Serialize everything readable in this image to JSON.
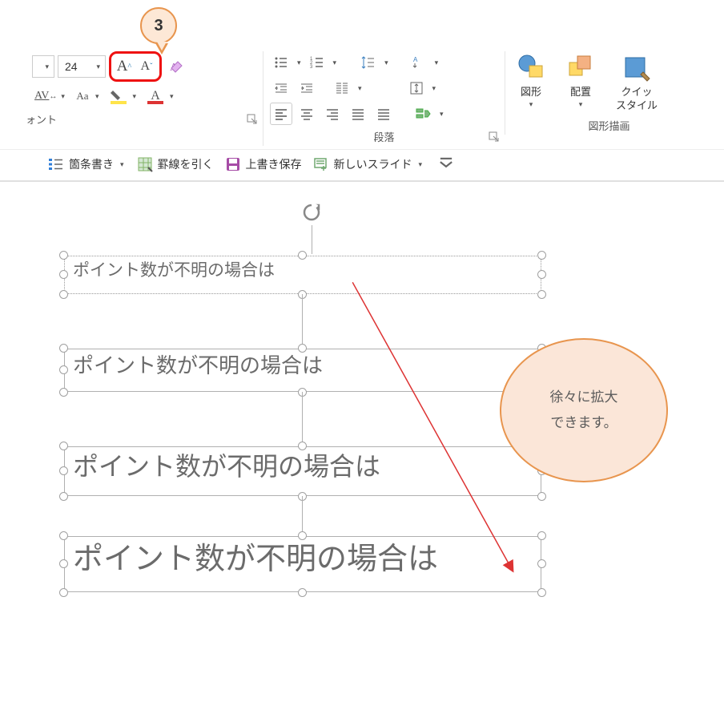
{
  "ribbon": {
    "badge_number": "3",
    "font_size": "24",
    "group_font_label": "ォント",
    "group_para_label": "段落",
    "group_draw_label": "図形描画",
    "shapes_label": "図形",
    "arrange_label": "配置",
    "quickstyle_label_1": "クイッ",
    "quickstyle_label_2": "スタイル"
  },
  "qat": {
    "bullet": "箇条書き",
    "grid": "罫線を引く",
    "save": "上書き保存",
    "newslide": "新しいスライド"
  },
  "canvas": {
    "text": "ポイント数が不明の場合は",
    "callout_line1": "徐々に拡大",
    "callout_line2": "できます。"
  }
}
